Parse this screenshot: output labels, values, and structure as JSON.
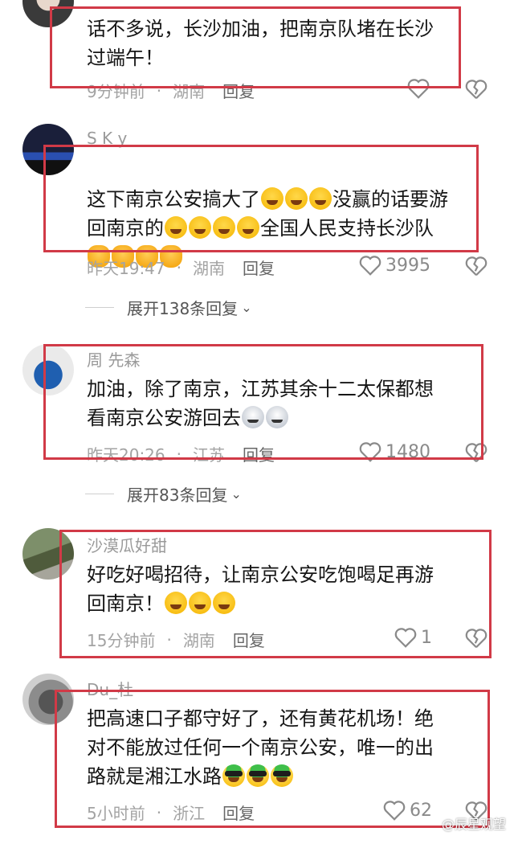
{
  "comments": [
    {
      "username": "",
      "text": "话不多说，长沙加油，把南京队堵在长沙\n过端午！",
      "time": "9分钟前",
      "region": "湖南",
      "reply_label": "回复",
      "likes": ""
    },
    {
      "username": "S K y",
      "text_a": "这下南京公安搞大了",
      "text_b": "没赢的话要游\n回南京的",
      "text_c": "全国人民支持长沙队",
      "time": "昨天19:47",
      "region": "湖南",
      "reply_label": "回复",
      "likes": "3995",
      "expand_label": "展开138条回复"
    },
    {
      "username": "周  先森",
      "text": "加油，除了南京，江苏其余十二太保都想\n看南京公安游回去",
      "time": "昨天20:26",
      "region": "江苏",
      "reply_label": "回复",
      "likes": "1480",
      "expand_label": "展开83条回复"
    },
    {
      "username": "沙漠瓜好甜",
      "text": "好吃好喝招待，让南京公安吃饱喝足再游\n回南京！",
      "time": "15分钟前",
      "region": "湖南",
      "reply_label": "回复",
      "likes": "1"
    },
    {
      "username": "Du_杜",
      "text": "把高速口子都守好了，还有黄花机场！绝\n对不能放过任何一个南京公安，唯一的出\n路就是湘江水路",
      "time": "5小时前",
      "region": "浙江",
      "reply_label": "回复",
      "likes": "62"
    }
  ],
  "watermark": "@辰星观望",
  "icons": {
    "like": "heart-outline-icon",
    "dislike": "broken-heart-icon",
    "expand": "chevron-down-icon"
  },
  "colors": {
    "highlight_box": "#d13a47",
    "meta_text": "#a3a3a3",
    "body_text": "#161616"
  }
}
